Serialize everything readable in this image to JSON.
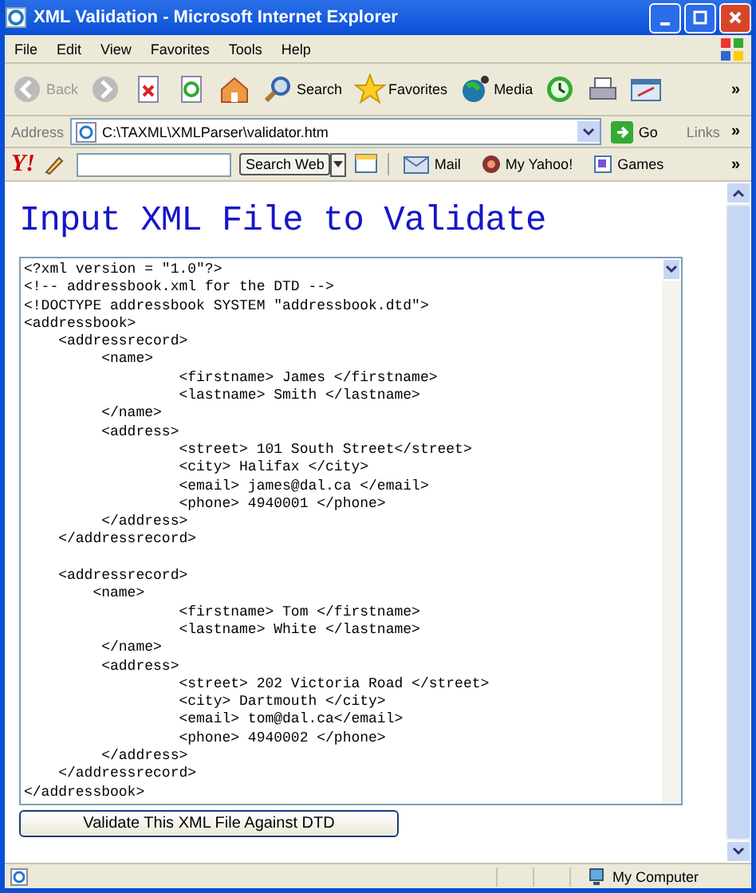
{
  "window": {
    "title": "XML Validation - Microsoft Internet Explorer"
  },
  "menu": [
    "File",
    "Edit",
    "View",
    "Favorites",
    "Tools",
    "Help"
  ],
  "toolbar": [
    {
      "kind": "back",
      "label": "Back",
      "disabled": true
    },
    {
      "kind": "forward",
      "disabled": true
    },
    {
      "kind": "stop"
    },
    {
      "kind": "refresh"
    },
    {
      "kind": "home"
    },
    {
      "kind": "search",
      "label": "Search"
    },
    {
      "kind": "favorites",
      "label": "Favorites"
    },
    {
      "kind": "media",
      "label": "Media"
    },
    {
      "kind": "history"
    },
    {
      "kind": "print"
    },
    {
      "kind": "edit"
    }
  ],
  "more": "»",
  "address": {
    "label": "Address",
    "value": "C:\\TAXML\\XMLParser\\validator.htm",
    "go": "Go",
    "links": "Links",
    "more": "»"
  },
  "yahoo": {
    "logo": "Y!",
    "search_button": "Search Web",
    "mail": "Mail",
    "my_yahoo": "My Yahoo!",
    "games": "Games",
    "more": "»"
  },
  "page": {
    "heading": "Input XML File to Validate",
    "xml_blocks": [
      [
        "<?xml version = \"1.0\"?>",
        "<!-- addressbook.xml for the DTD -->",
        "<!DOCTYPE addressbook SYSTEM \"addressbook.dtd\">",
        "<addressbook>",
        "    <addressrecord>",
        "         <name>",
        "                  <firstname> James </firstname>",
        "                  <lastname> Smith </lastname>",
        "         </name>",
        "         <address>",
        "                  <street> 101 South Street</street>",
        "                  <city> Halifax </city>",
        "                  <email> james@dal.ca </email>",
        "                  <phone> 4940001 </phone>",
        "         </address>",
        "    </addressrecord>"
      ],
      [
        "    <addressrecord>",
        "        <name>",
        "                  <firstname> Tom </firstname>",
        "                  <lastname> White </lastname>",
        "         </name>",
        "         <address>",
        "                  <street> 202 Victoria Road </street>",
        "                  <city> Dartmouth </city>",
        "                  <email> tom@dal.ca</email>",
        "                  <phone> 4940002 </phone>",
        "         </address>",
        "    </addressrecord>",
        "</addressbook>"
      ]
    ],
    "button": "Validate This XML File Against DTD"
  },
  "status_bar": {
    "zone": "My Computer"
  }
}
